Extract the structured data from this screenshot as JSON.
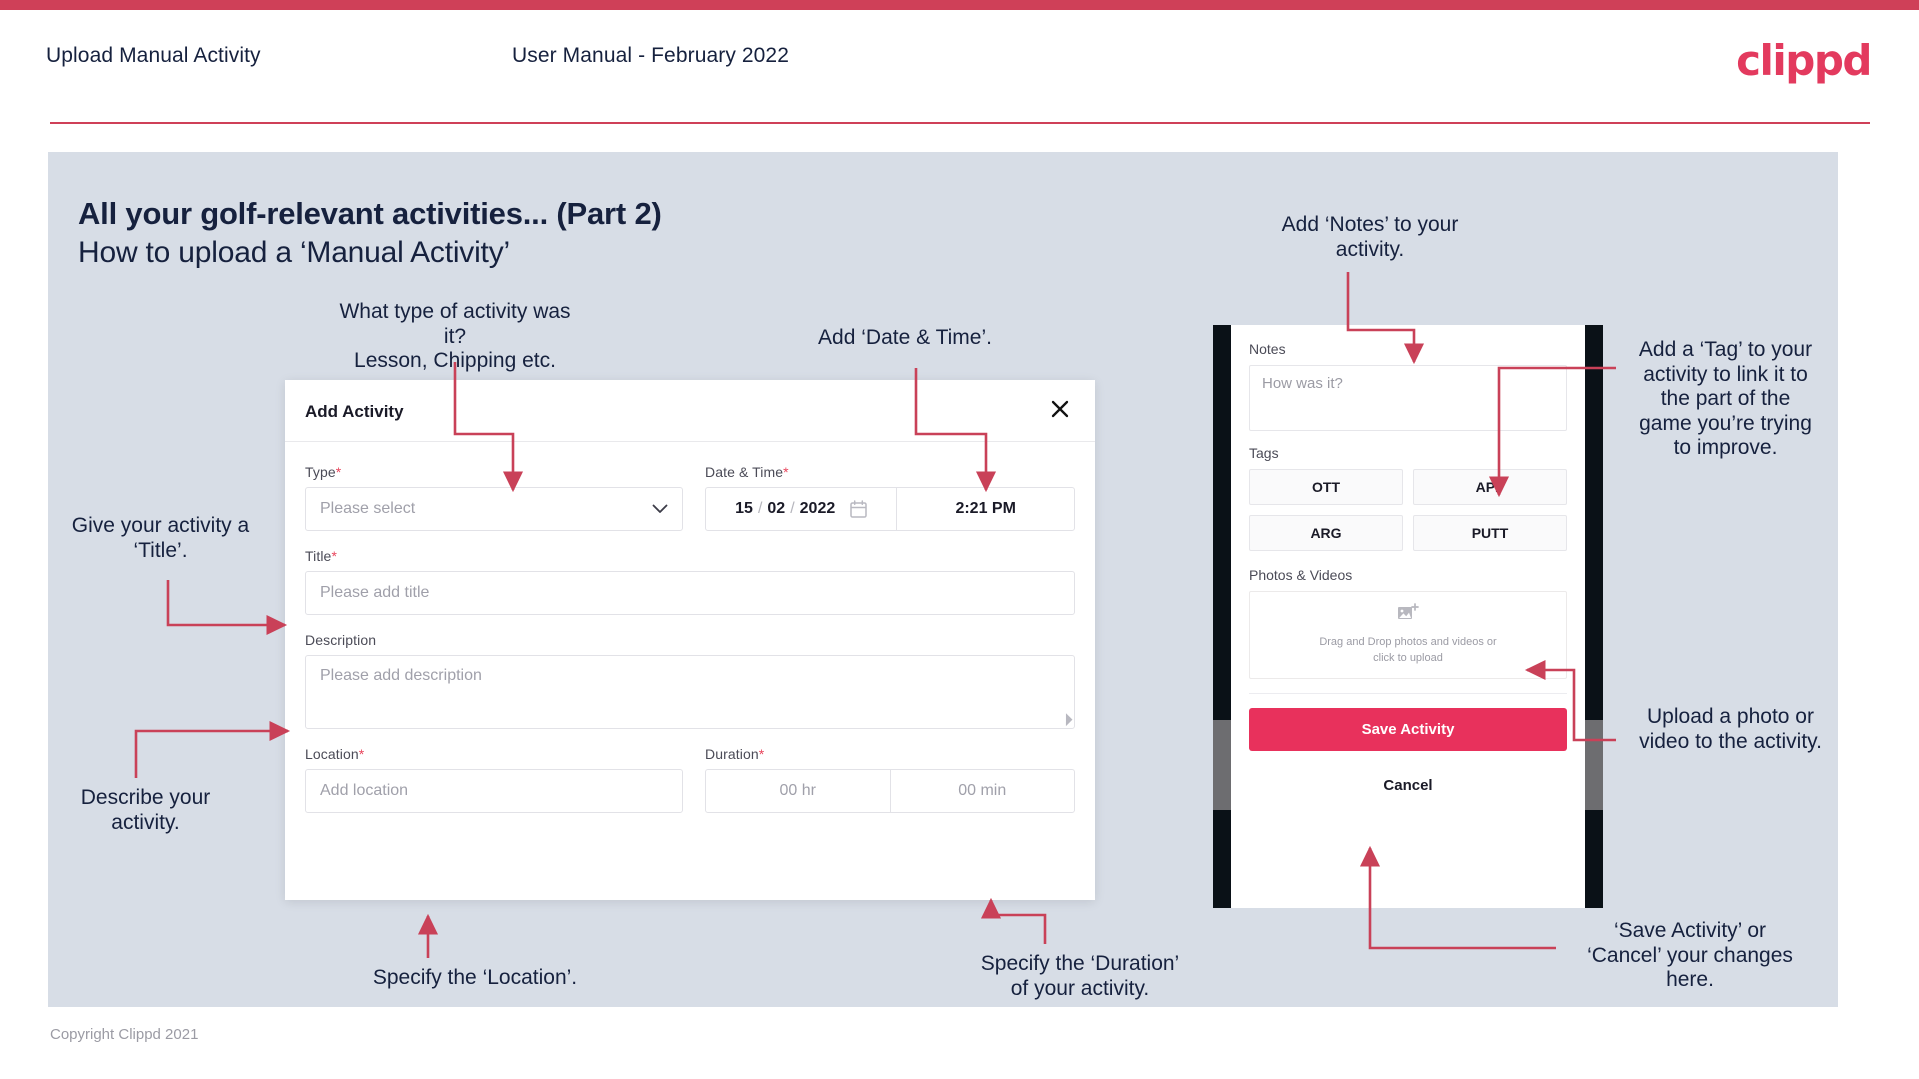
{
  "header": {
    "title": "Upload Manual Activity",
    "subtitle": "User Manual - February 2022",
    "logo": "clippd"
  },
  "slide": {
    "title": "All your golf-relevant activities... (Part 2)",
    "subtitle": "How to upload a ‘Manual Activity’"
  },
  "dialog": {
    "title": "Add Activity",
    "close_icon": "close-icon",
    "type": {
      "label": "Type",
      "required": "*",
      "placeholder": "Please select",
      "chevron": "⌄"
    },
    "datetime": {
      "label": "Date & Time",
      "required": "*",
      "day": "15",
      "month": "02",
      "year": "2022",
      "separator": "/",
      "time": "2:21 PM",
      "calendar_icon": "calendar-icon"
    },
    "title_field": {
      "label": "Title",
      "required": "*",
      "placeholder": "Please add title"
    },
    "description": {
      "label": "Description",
      "placeholder": "Please add description"
    },
    "location": {
      "label": "Location",
      "required": "*",
      "placeholder": "Add location"
    },
    "duration": {
      "label": "Duration",
      "required": "*",
      "hours": "00 hr",
      "minutes": "00 min"
    }
  },
  "phone": {
    "notes": {
      "label": "Notes",
      "placeholder": "How was it?"
    },
    "tags": {
      "label": "Tags",
      "items": [
        "OTT",
        "APP",
        "ARG",
        "PUTT"
      ]
    },
    "photos": {
      "label": "Photos & Videos",
      "icon": "add-image-icon",
      "drop_text": "Drag and Drop photos and videos or\nclick to upload"
    },
    "save_label": "Save Activity",
    "cancel_label": "Cancel"
  },
  "annotations": {
    "type": "What type of activity was it?\nLesson, Chipping etc.",
    "datetime": "Add ‘Date & Time’.",
    "title": "Give your activity a\n‘Title’.",
    "description": "Describe your\nactivity.",
    "location": "Specify the ‘Location’.",
    "duration": "Specify the ‘Duration’\nof your activity.",
    "notes": "Add ‘Notes’ to your\nactivity.",
    "tags": "Add a ‘Tag’ to your\nactivity to link it to\nthe part of the\ngame you’re trying\nto improve.",
    "photos": "Upload a photo or\nvideo to the activity.",
    "save": "‘Save Activity’ or\n‘Cancel’ your changes\nhere."
  },
  "footer": {
    "copyright": "Copyright Clippd 2021"
  },
  "colors": {
    "accent": "#cf4058",
    "brand": "#e33a5e",
    "save_button": "#e8315c",
    "panel_bg": "#d7dde6",
    "text_dark": "#16213e",
    "arrow": "#c94158"
  }
}
